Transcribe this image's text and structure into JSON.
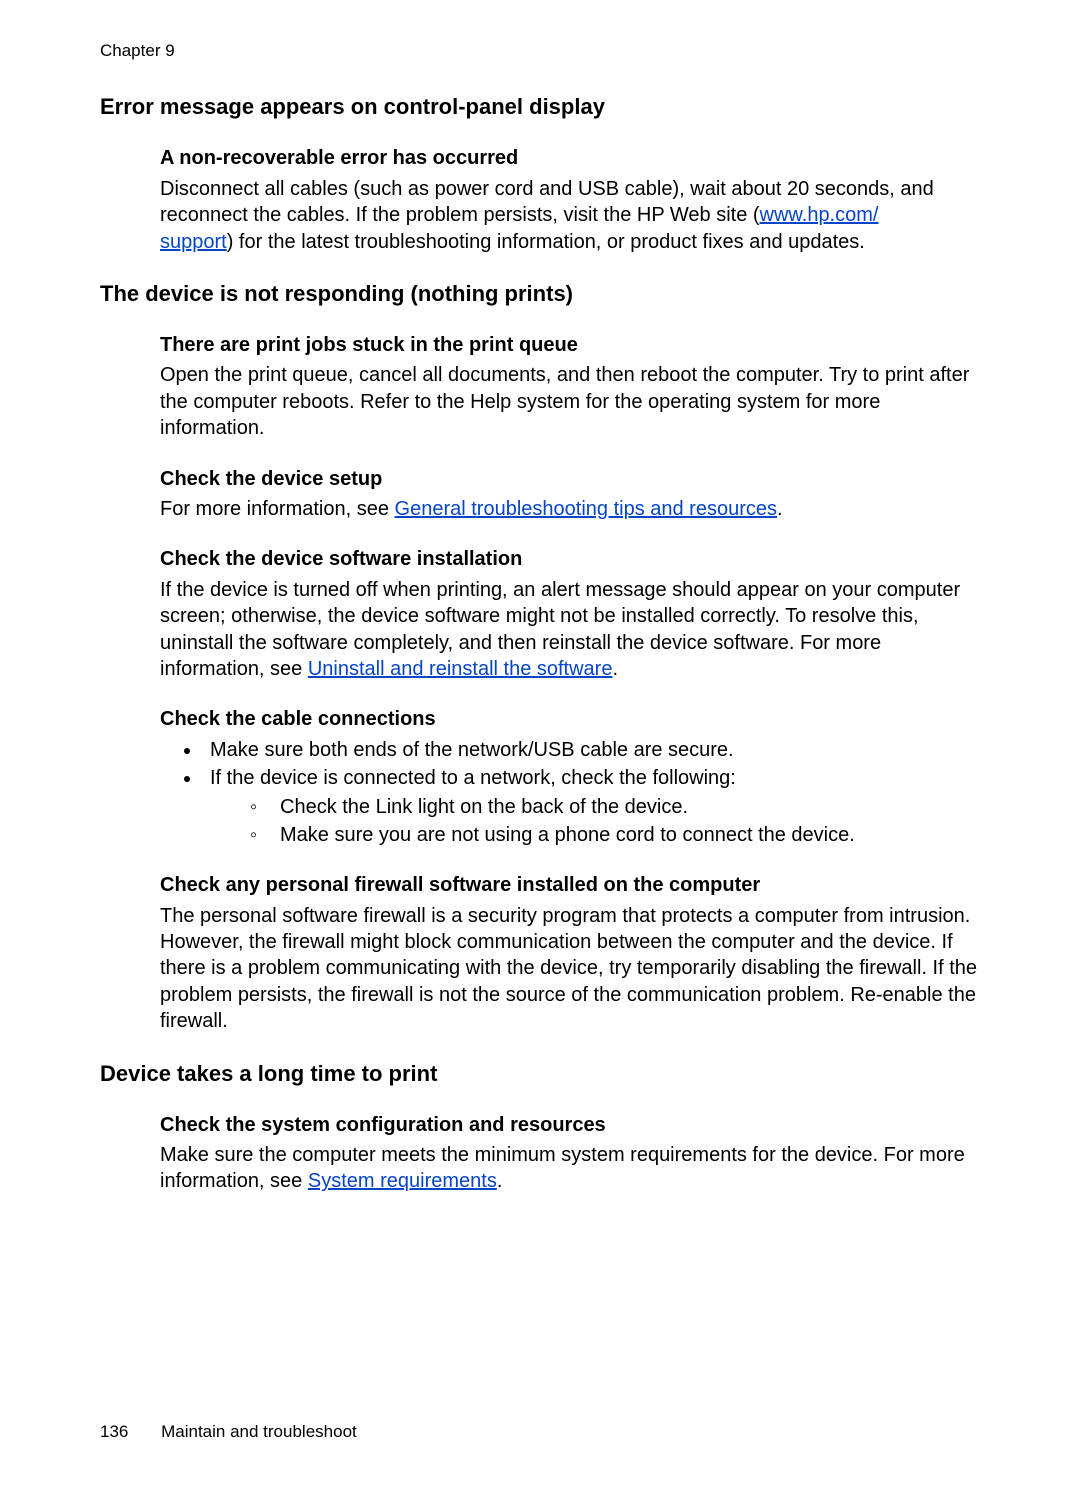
{
  "chapter": "Chapter 9",
  "sections": {
    "s1": {
      "title": "Error message appears on control-panel display",
      "sub1_h": "A non-recoverable error has occurred",
      "sub1_p_pre": "Disconnect all cables (such as power cord and USB cable), wait about 20 seconds, and reconnect the cables. If the problem persists, visit the HP Web site (",
      "sub1_link1": "www.hp.com/",
      "sub1_link2": "support",
      "sub1_p_post": ") for the latest troubleshooting information, or product fixes and updates."
    },
    "s2": {
      "title": "The device is not responding (nothing prints)",
      "sub1_h": "There are print jobs stuck in the print queue",
      "sub1_p": "Open the print queue, cancel all documents, and then reboot the computer. Try to print after the computer reboots. Refer to the Help system for the operating system for more information.",
      "sub2_h": "Check the device setup",
      "sub2_p_pre": "For more information, see ",
      "sub2_link": "General troubleshooting tips and resources",
      "sub2_p_post": ".",
      "sub3_h": "Check the device software installation",
      "sub3_p_pre": "If the device is turned off when printing, an alert message should appear on your computer screen; otherwise, the device software might not be installed correctly. To resolve this, uninstall the software completely, and then reinstall the device software. For more information, see ",
      "sub3_link": "Uninstall and reinstall the software",
      "sub3_p_post": ".",
      "sub4_h": "Check the cable connections",
      "sub4_li1": "Make sure both ends of the network/USB cable are secure.",
      "sub4_li2": "If the device is connected to a network, check the following:",
      "sub4_li2a": "Check the Link light on the back of the device.",
      "sub4_li2b": "Make sure you are not using a phone cord to connect the device.",
      "sub5_h": "Check any personal firewall software installed on the computer",
      "sub5_p": "The personal software firewall is a security program that protects a computer from intrusion. However, the firewall might block communication between the computer and the device. If there is a problem communicating with the device, try temporarily disabling the firewall. If the problem persists, the firewall is not the source of the communication problem. Re-enable the firewall."
    },
    "s3": {
      "title": "Device takes a long time to print",
      "sub1_h": "Check the system configuration and resources",
      "sub1_p_pre": "Make sure the computer meets the minimum system requirements for the device. For more information, see ",
      "sub1_link": "System requirements",
      "sub1_p_post": "."
    }
  },
  "footer": {
    "page": "136",
    "title": "Maintain and troubleshoot"
  }
}
